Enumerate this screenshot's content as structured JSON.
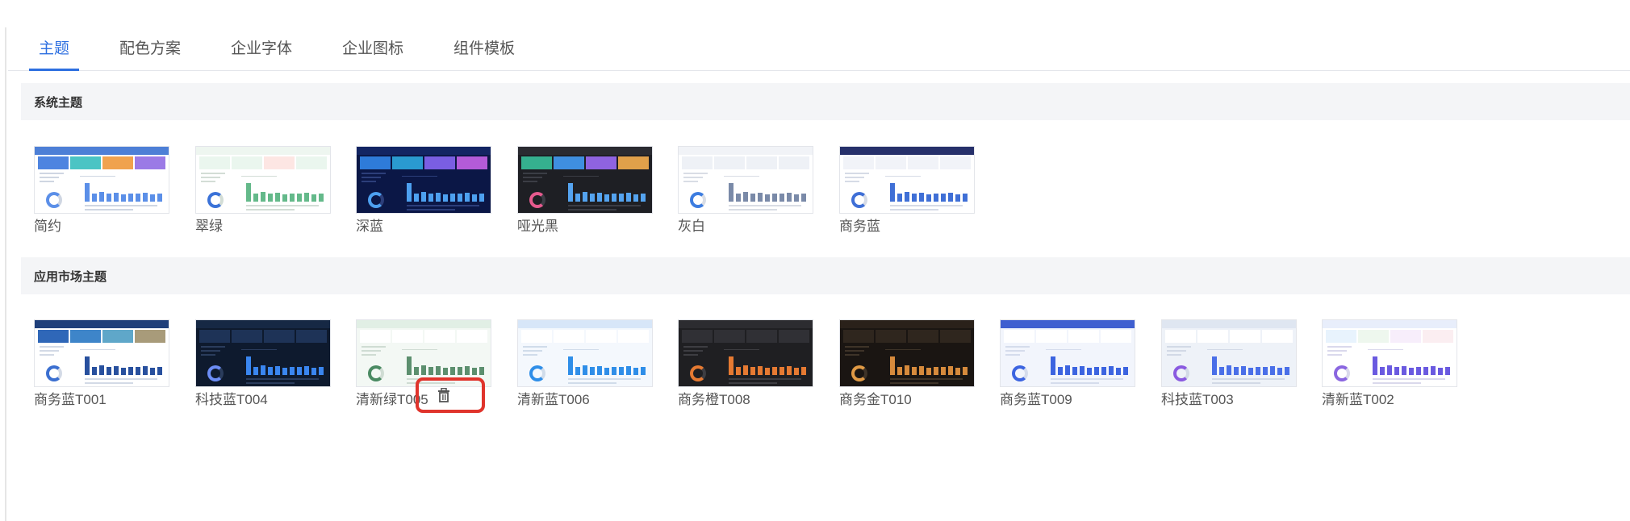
{
  "tabs": [
    {
      "label": "主题",
      "active": true
    },
    {
      "label": "配色方案",
      "active": false
    },
    {
      "label": "企业字体",
      "active": false
    },
    {
      "label": "企业图标",
      "active": false
    },
    {
      "label": "组件模板",
      "active": false
    }
  ],
  "system_section": {
    "title": "系统主题",
    "themes": [
      {
        "label": "简约",
        "bg": "#ffffff",
        "header": "#4d7fd6",
        "kpi": [
          "#4e84e0",
          "#4bc4c4",
          "#f0a24e",
          "#9b7ae6"
        ],
        "bar": "#5b8fe8",
        "text": "#cfd6e2",
        "donut": "#5b8fe8"
      },
      {
        "label": "翠绿",
        "bg": "#ffffff",
        "header": "#eef6f0",
        "kpi": [
          "#eaf6ee",
          "#eaf6ee",
          "#fde6e3",
          "#eaf6ee"
        ],
        "bar": "#64b98a",
        "text": "#d3ddd6",
        "donut": "#3a72d8"
      },
      {
        "label": "深蓝",
        "bg": "#0b1746",
        "header": "#132563",
        "kpi": [
          "#2e7bd9",
          "#2a9ad0",
          "#7a5ee2",
          "#b35bd8"
        ],
        "bar": "#4da0f0",
        "text": "#2c3e7a",
        "donut": "#4da0f0"
      },
      {
        "label": "哑光黑",
        "bg": "#1e1f24",
        "header": "#2a2b31",
        "kpi": [
          "#35b08f",
          "#3f8fe0",
          "#8f63e0",
          "#e0a04a"
        ],
        "bar": "#54a3ef",
        "text": "#3b3d45",
        "donut": "#e65a8e"
      },
      {
        "label": "灰白",
        "bg": "#ffffff",
        "header": "#f1f3f7",
        "kpi": [
          "#eef1f6",
          "#eef1f6",
          "#eef1f6",
          "#eef1f6"
        ],
        "bar": "#7a8aa8",
        "text": "#d9dde5",
        "donut": "#3d7de0"
      },
      {
        "label": "商务蓝",
        "bg": "#ffffff",
        "header": "#26306a",
        "kpi": [
          "#f1f3f8",
          "#f1f3f8",
          "#f1f3f8",
          "#f1f3f8"
        ],
        "bar": "#3f6fd6",
        "text": "#d6dbe6",
        "donut": "#3f6fd6"
      }
    ]
  },
  "market_section": {
    "title": "应用市场主题",
    "themes": [
      {
        "label": "商务蓝T001",
        "bg": "#ffffff",
        "header": "#1f3f7a",
        "kpi": [
          "#2f67b8",
          "#3e85c9",
          "#5fa7c9",
          "#a89b7a"
        ],
        "bar": "#28509e",
        "text": "#d3dae6",
        "donut": "#3b6fd0"
      },
      {
        "label": "科技蓝T004",
        "bg": "#0e1a2e",
        "header": "#162844",
        "kpi": [
          "#1e3357",
          "#1e3357",
          "#1e3357",
          "#1e3357"
        ],
        "bar": "#3a86f0",
        "text": "#2a3c5c",
        "donut": "#6c8df5"
      },
      {
        "label": "清新绿T005",
        "bg": "#f3f8f4",
        "header": "#e1efe5",
        "kpi": [
          "#ffffff",
          "#ffffff",
          "#ffffff",
          "#ffffff"
        ],
        "bar": "#5c8f6e",
        "text": "#cfdcd3",
        "donut": "#4a8a62"
      },
      {
        "label": "清新蓝T006",
        "bg": "#f4f8fd",
        "header": "#d7e6f8",
        "kpi": [
          "#ffffff",
          "#ffffff",
          "#ffffff",
          "#ffffff"
        ],
        "bar": "#2f8ee8",
        "text": "#d0dcea",
        "donut": "#2f8ee8"
      },
      {
        "label": "商务橙T008",
        "bg": "#1f1f22",
        "header": "#2c2c30",
        "kpi": [
          "#303035",
          "#303035",
          "#303035",
          "#303035"
        ],
        "bar": "#e67a32",
        "text": "#3d3d42",
        "donut": "#e67a32"
      },
      {
        "label": "商务金T010",
        "bg": "#1a1512",
        "header": "#2a211a",
        "kpi": [
          "#2f261e",
          "#2f261e",
          "#2f261e",
          "#2f261e"
        ],
        "bar": "#d68a3c",
        "text": "#3e3328",
        "donut": "#e09a45"
      },
      {
        "label": "商务蓝T009",
        "bg": "#f2f5fc",
        "header": "#3f5fd0",
        "kpi": [
          "#ffffff",
          "#ffffff",
          "#ffffff",
          "#ffffff"
        ],
        "bar": "#3c64e0",
        "text": "#d5dcec",
        "donut": "#3c64e0"
      },
      {
        "label": "科技蓝T003",
        "bg": "#eef2f8",
        "header": "#dfe6f1",
        "kpi": [
          "#ffffff",
          "#ffffff",
          "#ffffff",
          "#ffffff"
        ],
        "bar": "#4a6fe8",
        "text": "#d2d9e6",
        "donut": "#8a5ae0"
      },
      {
        "label": "清新蓝T002",
        "bg": "#ffffff",
        "header": "#e8eefb",
        "kpi": [
          "#e8f3fd",
          "#eef7ee",
          "#f7eefb",
          "#fbeef1"
        ],
        "bar": "#6a5ae0",
        "text": "#dad9ec",
        "donut": "#8a66e0"
      }
    ]
  },
  "overlay": {
    "delete_icon": "trash-icon",
    "highlight_color": "#e0342c"
  }
}
